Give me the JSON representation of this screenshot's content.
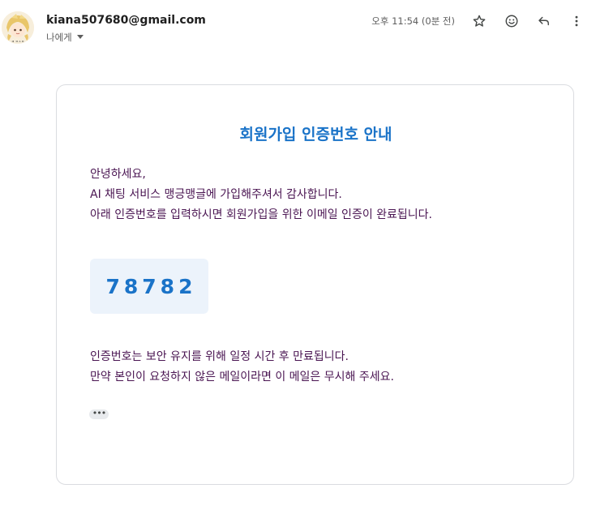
{
  "header": {
    "sender": "kiana507680@gmail.com",
    "recipient_label": "나에게",
    "timestamp": "오후 11:54 (0분 전)",
    "icons": [
      "star-icon",
      "emoji-icon",
      "reply-icon",
      "more-vert-icon"
    ]
  },
  "email": {
    "title": "회원가입 인증번호 안내",
    "greeting": "안녕하세요,",
    "intro_line": "AI 채팅 서비스 맹긍맹글에 가입해주셔서 감사합니다.",
    "instruction_line": "아래 인증번호를 입력하시면 회원가입을 위한 이메일 인증이 완료됩니다.",
    "code": "78782",
    "expiry_line": "인증번호는 보안 유지를 위해 일정 시간 후 만료됩니다.",
    "ignore_line": "만약 본인이 요청하지 않은 메일이라면 이 메일은 무시해 주세요.",
    "more_label": "•••"
  },
  "colors": {
    "accent": "#1a73c8",
    "body_text": "#4a1552",
    "code_bg": "#ecf3fb",
    "card_border": "#dadce0"
  }
}
